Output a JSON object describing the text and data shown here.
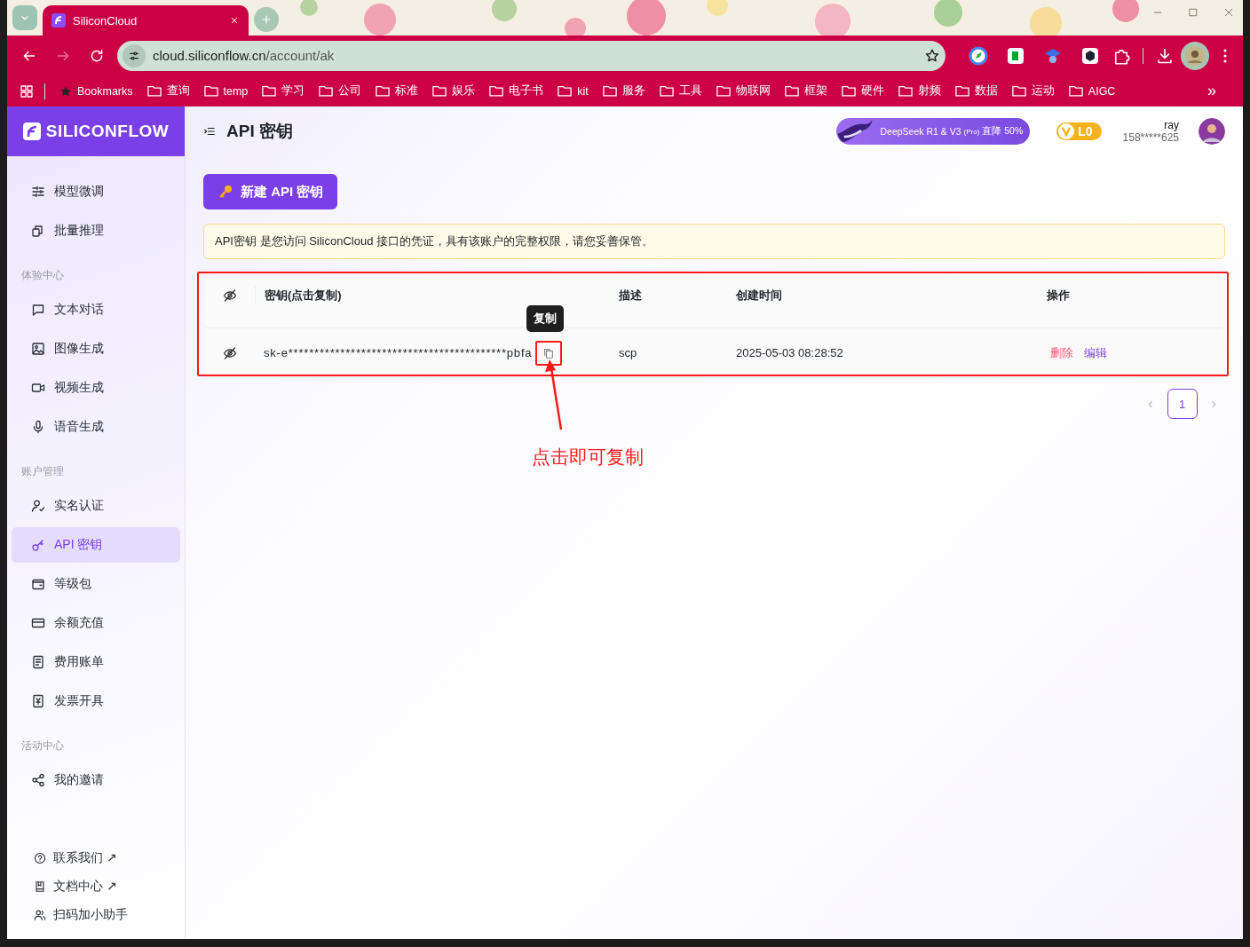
{
  "browser": {
    "tabs": [
      {
        "title": "SiliconCloud",
        "selected": true
      }
    ],
    "url": {
      "host": "cloud.siliconflow.cn",
      "path": "/account/ak"
    },
    "bookmarks": [
      "Bookmarks",
      "查询",
      "temp",
      "学习",
      "公司",
      "标准",
      "娱乐",
      "电子书",
      "kit",
      "服务",
      "工具",
      "物联网",
      "框架",
      "硬件",
      "射频",
      "数据",
      "运动",
      "AIGC"
    ],
    "more": "»"
  },
  "sidebar": {
    "logo": "SILICONFLOW",
    "sections": [
      {
        "items": [
          {
            "label": "模型微调",
            "selected": false
          },
          {
            "label": "批量推理",
            "selected": false
          }
        ]
      },
      {
        "title": "体验中心",
        "items": [
          {
            "label": "文本对话",
            "selected": false
          },
          {
            "label": "图像生成",
            "selected": false
          },
          {
            "label": "视频生成",
            "selected": false
          },
          {
            "label": "语音生成",
            "selected": false
          }
        ]
      },
      {
        "title": "账户管理",
        "items": [
          {
            "label": "实名认证",
            "selected": false
          },
          {
            "label": "API 密钥",
            "selected": true
          },
          {
            "label": "等级包",
            "selected": false
          },
          {
            "label": "余额充值",
            "selected": false
          },
          {
            "label": "费用账单",
            "selected": false
          },
          {
            "label": "发票开具",
            "selected": false
          }
        ]
      },
      {
        "title": "活动中心",
        "items": [
          {
            "label": "我的邀请",
            "selected": false
          }
        ]
      }
    ],
    "footer": [
      "联系我们 ↗",
      "文档中心 ↗",
      "扫码加小助手"
    ]
  },
  "header": {
    "title": "API 密钥",
    "promo": {
      "text": "DeepSeek R1 & V3",
      "tag": "(Pro)",
      "discount": "直降 50%"
    },
    "level": "L0",
    "user": {
      "name": "ray",
      "phone": "158*****625"
    }
  },
  "new_key_button": "新建 API 密钥",
  "notice": "API密钥 是您访问 SiliconCloud 接口的凭证，具有该账户的完整权限，请您妥善保管。",
  "table": {
    "columns": [
      "密钥(点击复制)",
      "描述",
      "创建时间",
      "操作"
    ],
    "rows": [
      {
        "key": "sk-e******************************************pbfa",
        "description": "scp",
        "created": "2025-05-03 08:28:52",
        "actions": [
          {
            "label": "删除",
            "kind": "danger"
          },
          {
            "label": "编辑",
            "kind": "primary"
          }
        ]
      }
    ]
  },
  "tooltip": "复制",
  "pagination": {
    "prev": "‹",
    "next": "›",
    "pages": [
      {
        "label": "1",
        "selected": true
      }
    ]
  },
  "annotation": "点击即可复制"
}
